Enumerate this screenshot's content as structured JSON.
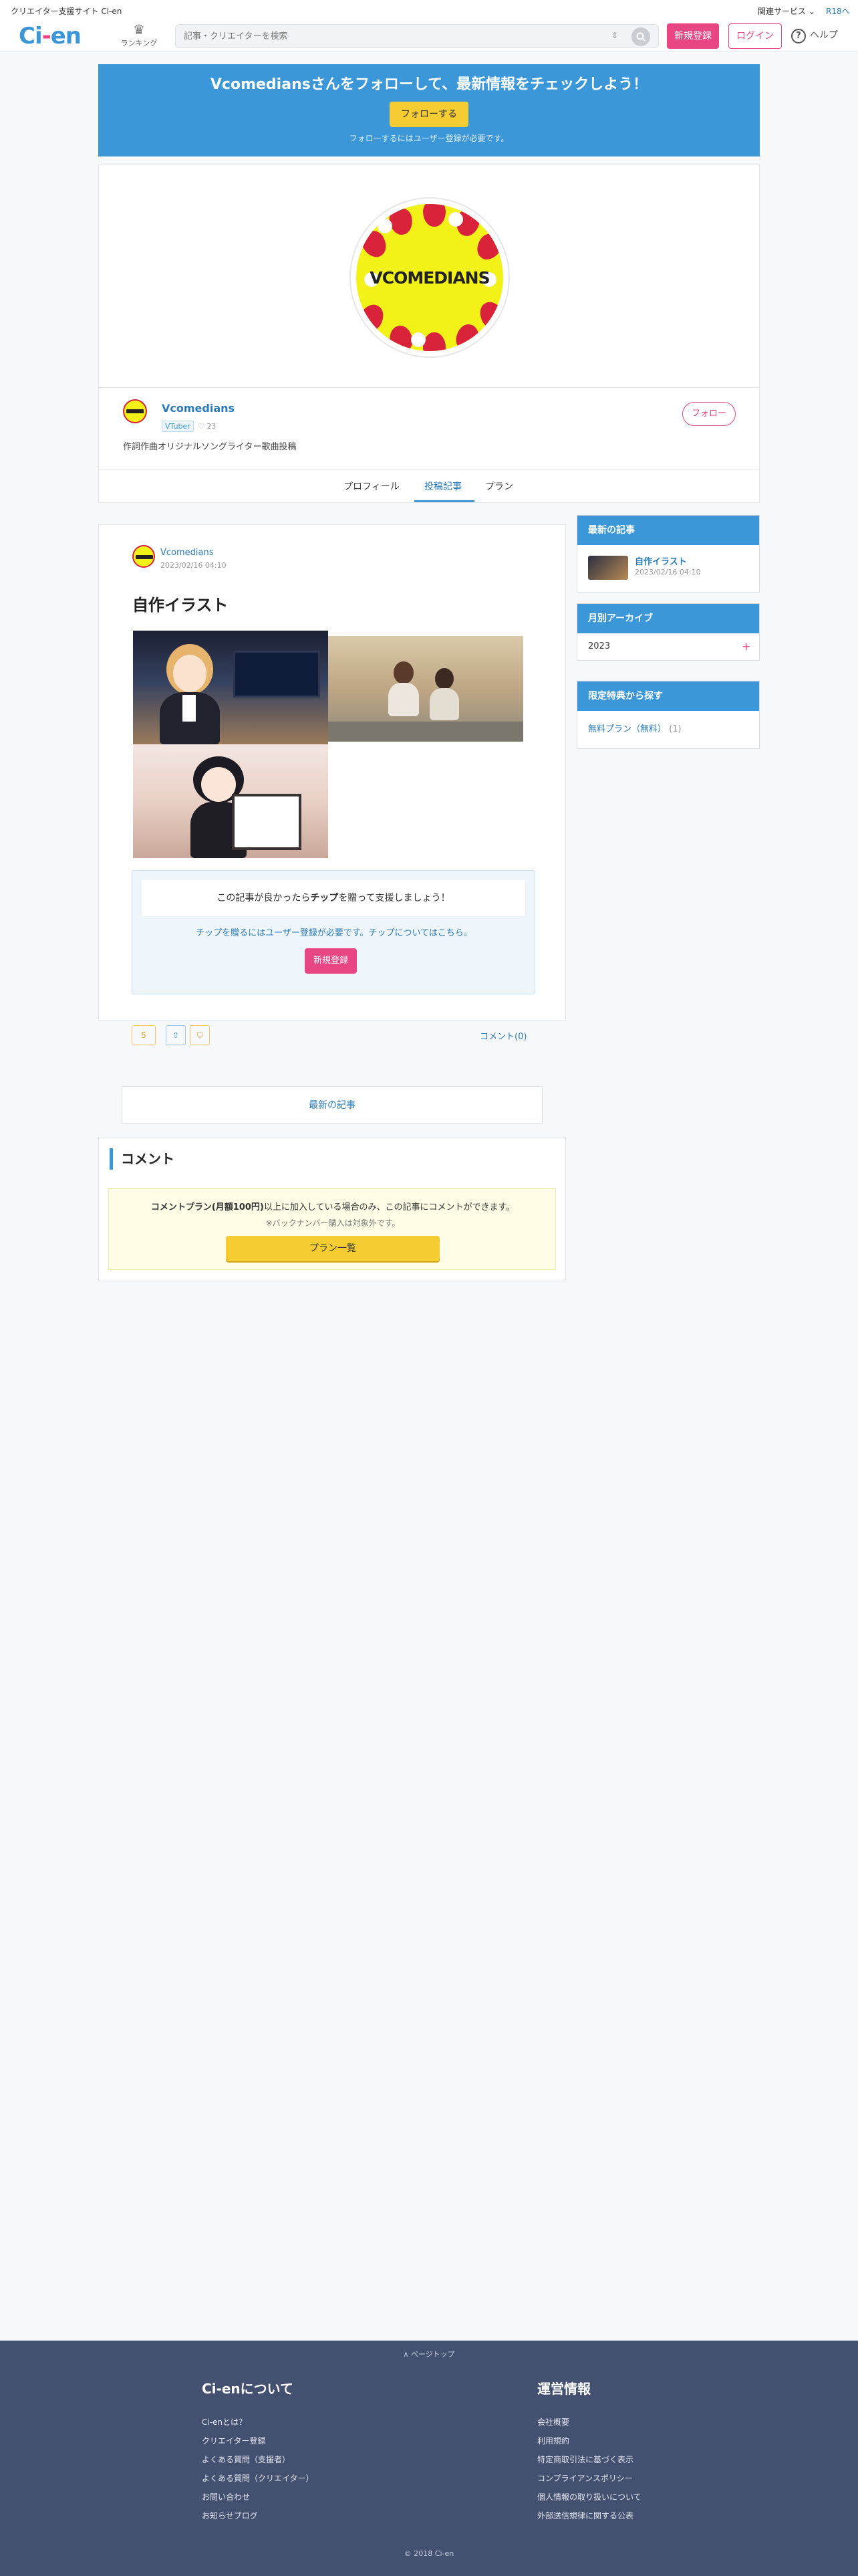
{
  "topbar": {
    "site_label": "クリエイター支援サイト Ci-en",
    "related_label": "関連サービス",
    "r18_label": "R18へ"
  },
  "header": {
    "logo_text": {
      "ci": "Ci",
      "dash": "-",
      "en": "en"
    },
    "ranking_label": "ランキング",
    "search": {
      "placeholder": "記事・クリエイターを検索"
    },
    "signup_label": "新規登録",
    "login_label": "ログイン",
    "help_label": "ヘルプ"
  },
  "banner": {
    "title": "Vcomediansさんをフォローして、最新情報をチェックしよう！",
    "follow_label": "フォローする",
    "note": "フォローするにはユーザー登録が必要です。"
  },
  "creator": {
    "name": "Vcomedians",
    "category": "VTuber",
    "fans": "♡ 23",
    "description": "作詞作曲オリジナルソングライター歌曲投稿",
    "follow_label": "フォロー",
    "cover_text": "VCOMEDIANS"
  },
  "tabs": [
    {
      "label": "プロフィール"
    },
    {
      "label": "投稿記事",
      "active": true
    },
    {
      "label": "プラン"
    }
  ],
  "article": {
    "author": "Vcomedians",
    "date": "2023/02/16 04:10",
    "title": "自作イラスト",
    "tip": {
      "message_pre": "この記事が良かったら",
      "message_bold": "チップ",
      "message_post": "を贈って支援しましょう！",
      "link": "チップを贈るにはユーザー登録が必要です。チップについてはこちら。",
      "signup_label": "新規登録"
    },
    "reactions": {
      "like": "5",
      "share": "⇧",
      "bookmark": "⛉"
    },
    "comment_link": "コメント(0)"
  },
  "latest_button": "最新の記事",
  "comments": {
    "title": "コメント",
    "notice_bold": "コメントプラン(月額100円)",
    "notice_rest": "以上に加入している場合のみ、この記事にコメントができます。",
    "sub_note": "※バックナンバー購入は対象外です。",
    "plan_button": "プラン一覧"
  },
  "sidebar": {
    "latest": {
      "header": "最新の記事",
      "title": "自作イラスト",
      "date": "2023/02/16 04:10"
    },
    "archive": {
      "header": "月別アーカイブ",
      "year": "2023",
      "expand": "+"
    },
    "benefits": {
      "header": "限定特典から探す",
      "plan": "無料プラン（無料）",
      "count": "(1)"
    }
  },
  "footer": {
    "pagetop": "∧ ページトップ",
    "about": {
      "heading": "Ci-enについて",
      "links": [
        "Ci-enとは？",
        "クリエイター登録",
        "よくある質問（支援者）",
        "よくある質問（クリエイター）",
        "お問い合わせ",
        "お知らせブログ"
      ]
    },
    "operations": {
      "heading": "運営情報",
      "links": [
        "会社概要",
        "利用規約",
        "特定商取引法に基づく表示",
        "コンプライアンスポリシー",
        "個人情報の取り扱いについて",
        "外部送信規律に関する公表"
      ]
    },
    "copyright": "© 2018 Ci-en"
  },
  "colors": {
    "brand_blue": "#3b97d8",
    "brand_pink": "#e84583",
    "follow_yellow": "#f5cd32",
    "footer_bg": "#44506f"
  }
}
